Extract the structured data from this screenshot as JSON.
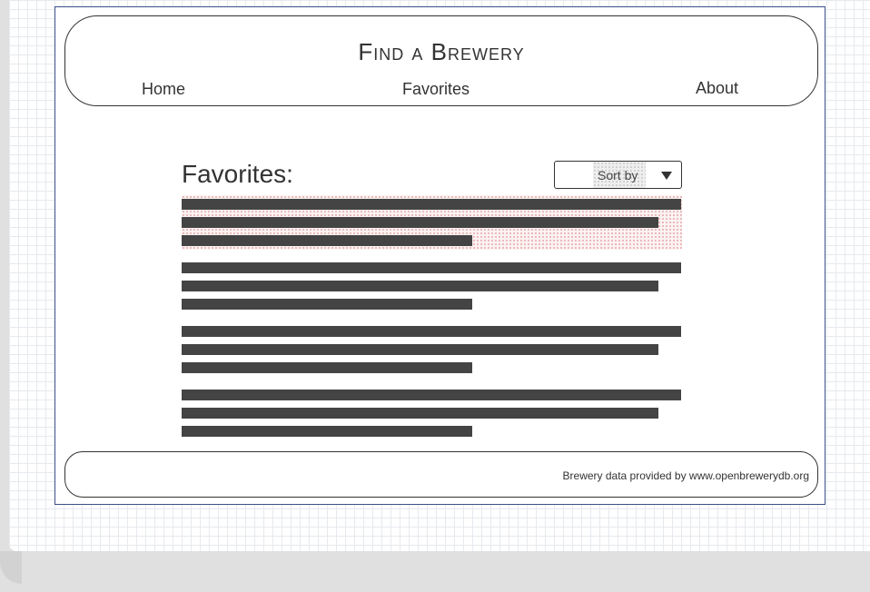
{
  "header": {
    "title": "Find a Brewery",
    "nav": {
      "home": "Home",
      "favorites": "Favorites",
      "about": "About"
    }
  },
  "main": {
    "heading": "Favorites:",
    "sort": {
      "label": "Sort by",
      "icon": "caret-down-icon"
    },
    "items_count": 4,
    "selected_item": 1
  },
  "footer": {
    "credit": "Brewery data provided by www.openbrewerydb.org"
  },
  "colors": {
    "frame_border": "#3a4f8a",
    "text_placeholder": "#444444",
    "selection_dots": "#e7a8a8"
  }
}
